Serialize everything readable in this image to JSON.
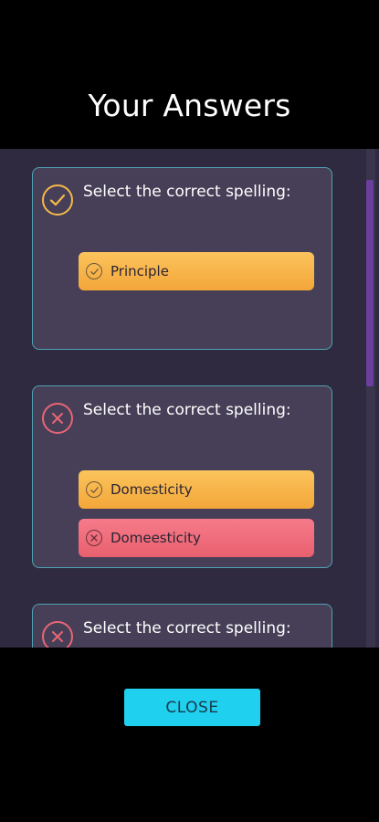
{
  "screen": {
    "title": "Your Answers"
  },
  "questions": [
    {
      "status": "correct",
      "status_icon": "check-circle-icon",
      "prompt": "Select the correct spelling:",
      "options": [
        {
          "label": "Principle",
          "state": "correct",
          "icon": "check-circle-icon"
        }
      ]
    },
    {
      "status": "wrong",
      "status_icon": "x-circle-icon",
      "prompt": "Select the correct spelling:",
      "options": [
        {
          "label": "Domesticity",
          "state": "correct",
          "icon": "check-circle-icon"
        },
        {
          "label": "Domeesticity",
          "state": "wrong",
          "icon": "x-circle-icon"
        }
      ]
    },
    {
      "status": "wrong",
      "status_icon": "x-circle-icon",
      "prompt": "Select the correct spelling:",
      "options": []
    }
  ],
  "footer": {
    "close_label": "CLOSE"
  },
  "colors": {
    "correct": "#f5b94a",
    "wrong": "#e86675",
    "card_border": "#4fa3b3",
    "button": "#1fd0ef",
    "scrollbar": "#6a3f9e"
  }
}
